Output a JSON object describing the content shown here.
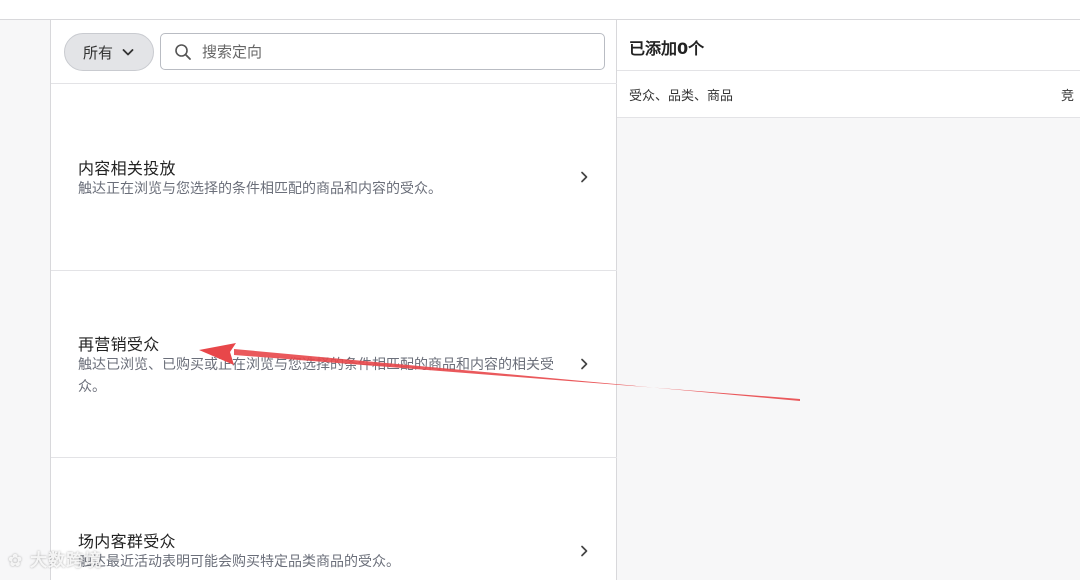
{
  "filter": {
    "label": "所有"
  },
  "search": {
    "placeholder": "搜索定向",
    "value": ""
  },
  "items": [
    {
      "title": "内容相关投放",
      "description": "触达正在浏览与您选择的条件相匹配的商品和内容的受众。"
    },
    {
      "title": "再营销受众",
      "description": "触达已浏览、已购买或正在浏览与您选择的条件相匹配的商品和内容的相关受众。"
    },
    {
      "title": "场内客群受众",
      "description": "触达最近活动表明可能会购买特定品类商品的受众。"
    }
  ],
  "right": {
    "title": "已添加0个",
    "columns": {
      "left": "受众、品类、商品",
      "right": "竞"
    }
  },
  "annotation": {
    "arrow_color": "#e8474a"
  },
  "watermark": {
    "text": "大数跨境"
  },
  "icons": {
    "search": "search-icon",
    "chevron": "chevron-right-icon",
    "dropdown": "chevron-down-icon"
  }
}
